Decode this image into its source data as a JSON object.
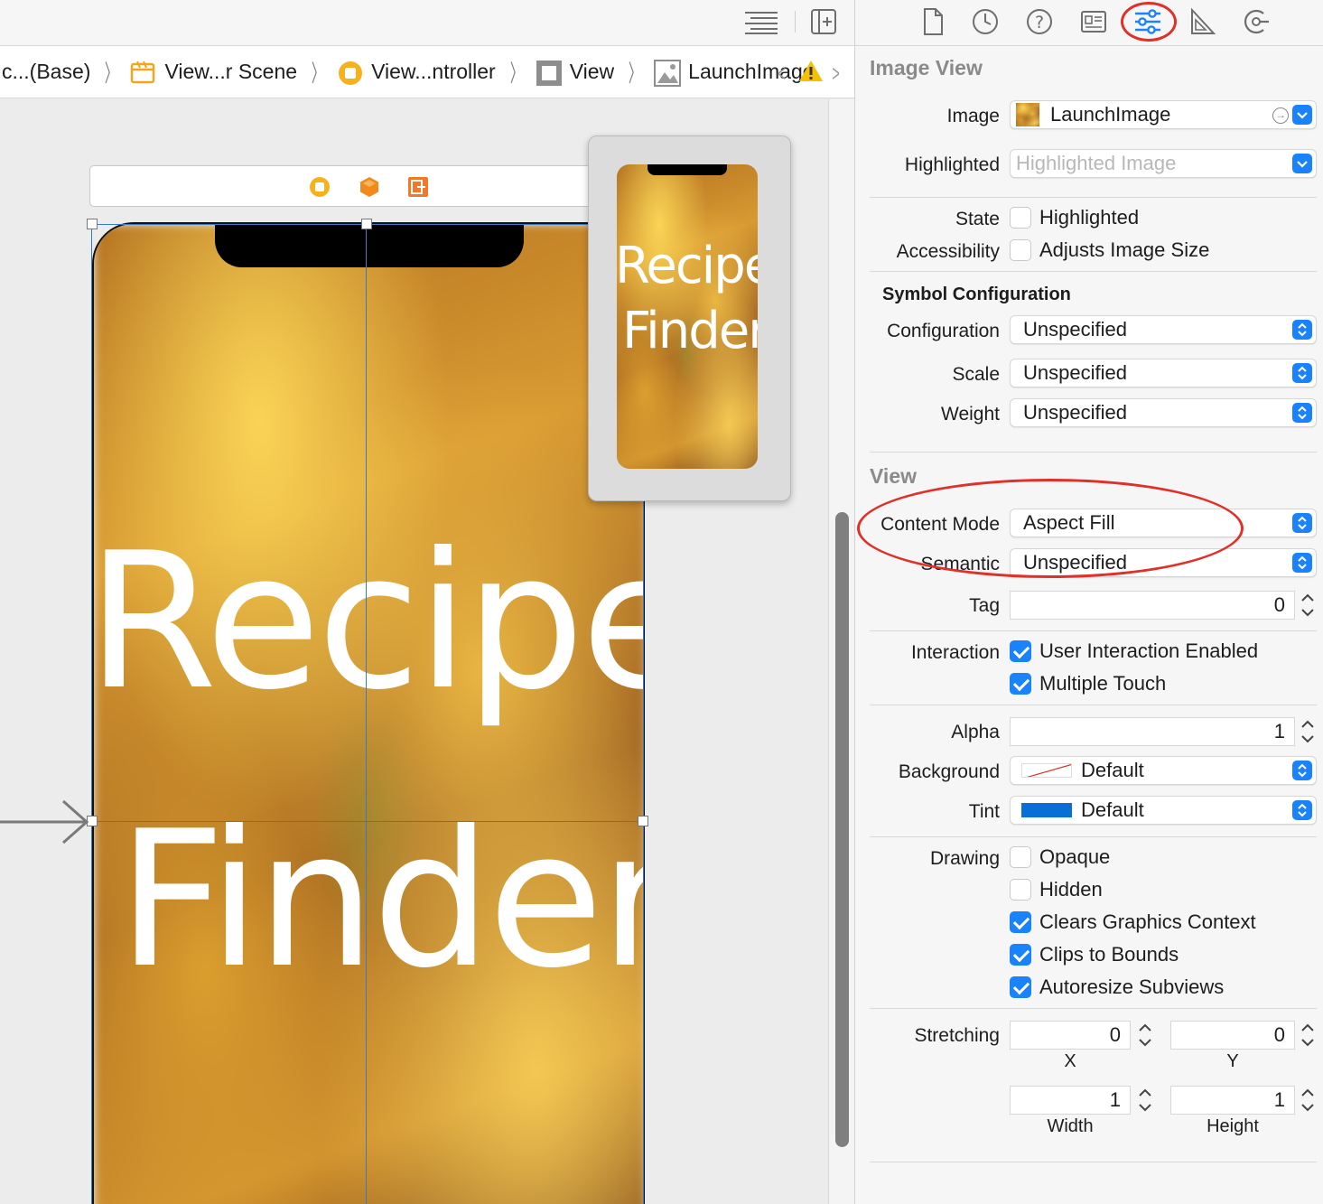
{
  "breadcrumbs": {
    "items": [
      {
        "label": "c...(Base)",
        "icon": "none"
      },
      {
        "label": "View...r Scene",
        "icon": "scene-icon"
      },
      {
        "label": "View...ntroller",
        "icon": "view-controller-icon"
      },
      {
        "label": "View",
        "icon": "view-icon"
      },
      {
        "label": "LaunchImage",
        "icon": "image-view-icon"
      }
    ],
    "separator": "〉"
  },
  "canvas": {
    "title_line1": "Recipe",
    "title_line2": "Finder",
    "preview_line1": "Recipe",
    "preview_line2": "Finder"
  },
  "inspector": {
    "image_view": {
      "title": "Image View",
      "image_label": "Image",
      "image_value": "LaunchImage",
      "highlighted_label": "Highlighted",
      "highlighted_placeholder": "Highlighted Image",
      "state_label": "State",
      "state_option": "Highlighted",
      "accessibility_label": "Accessibility",
      "accessibility_option": "Adjusts Image Size",
      "symbol_config_title": "Symbol Configuration",
      "configuration_label": "Configuration",
      "configuration_value": "Unspecified",
      "scale_label": "Scale",
      "scale_value": "Unspecified",
      "weight_label": "Weight",
      "weight_value": "Unspecified"
    },
    "view": {
      "title": "View",
      "content_mode_label": "Content Mode",
      "content_mode_value": "Aspect Fill",
      "semantic_label": "Semantic",
      "semantic_value": "Unspecified",
      "tag_label": "Tag",
      "tag_value": "0",
      "interaction_label": "Interaction",
      "user_interaction": "User Interaction Enabled",
      "multiple_touch": "Multiple Touch",
      "alpha_label": "Alpha",
      "alpha_value": "1",
      "background_label": "Background",
      "background_value": "Default",
      "tint_label": "Tint",
      "tint_value": "Default",
      "drawing_label": "Drawing",
      "opaque": "Opaque",
      "hidden": "Hidden",
      "clears_graphics": "Clears Graphics Context",
      "clips_to_bounds": "Clips to Bounds",
      "autoresize": "Autoresize Subviews",
      "stretching_label": "Stretching",
      "stretch_x_value": "0",
      "stretch_y_value": "0",
      "stretch_w_value": "1",
      "stretch_h_value": "1",
      "x_caption": "X",
      "y_caption": "Y",
      "width_caption": "Width",
      "height_caption": "Height"
    }
  },
  "colors": {
    "accent": "#1a82fb",
    "highlight_annotation": "#e0302a",
    "tint": "#0a6ed8"
  }
}
